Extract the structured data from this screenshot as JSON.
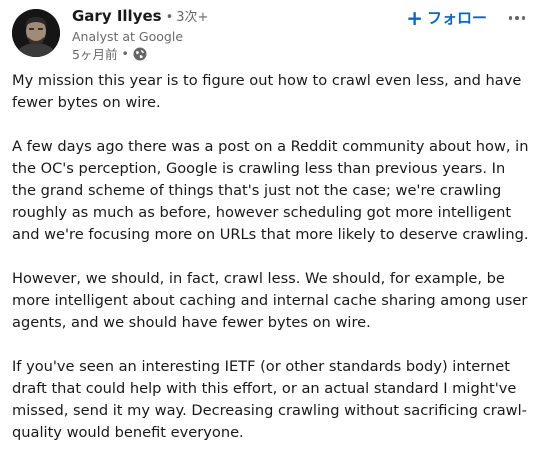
{
  "author": {
    "name": "Gary Illyes",
    "separator": "•",
    "degree": "3次+",
    "headline": "Analyst at Google",
    "time": "5ヶ月前",
    "time_separator": "•",
    "visibility_icon": "globe-icon",
    "avatar_icon": "avatar-photo"
  },
  "actions": {
    "follow_plus": "+",
    "follow_label": "フォロー",
    "more_icon": "more-horizontal-icon",
    "accent_color": "#0a66c2"
  },
  "post": {
    "paragraphs": [
      "My mission this year is to figure out how to crawl even less, and have fewer bytes on wire.",
      "A few days ago there was a post on a Reddit community about how, in the OC's perception, Google is crawling less than previous years. In the grand scheme of things that's just not the case; we're crawling roughly as much as before, however scheduling got more intelligent and we're focusing more on URLs that more likely to deserve crawling.",
      "However, we should, in fact, crawl less. We should, for example, be more intelligent about caching and internal cache sharing among user agents, and we should have fewer bytes on wire.",
      "If you've seen an interesting IETF (or other standards body) internet draft that could help with this effort, or an actual standard I might've missed, send it my way. Decreasing crawling without sacrificing crawl-quality would benefit everyone."
    ]
  }
}
